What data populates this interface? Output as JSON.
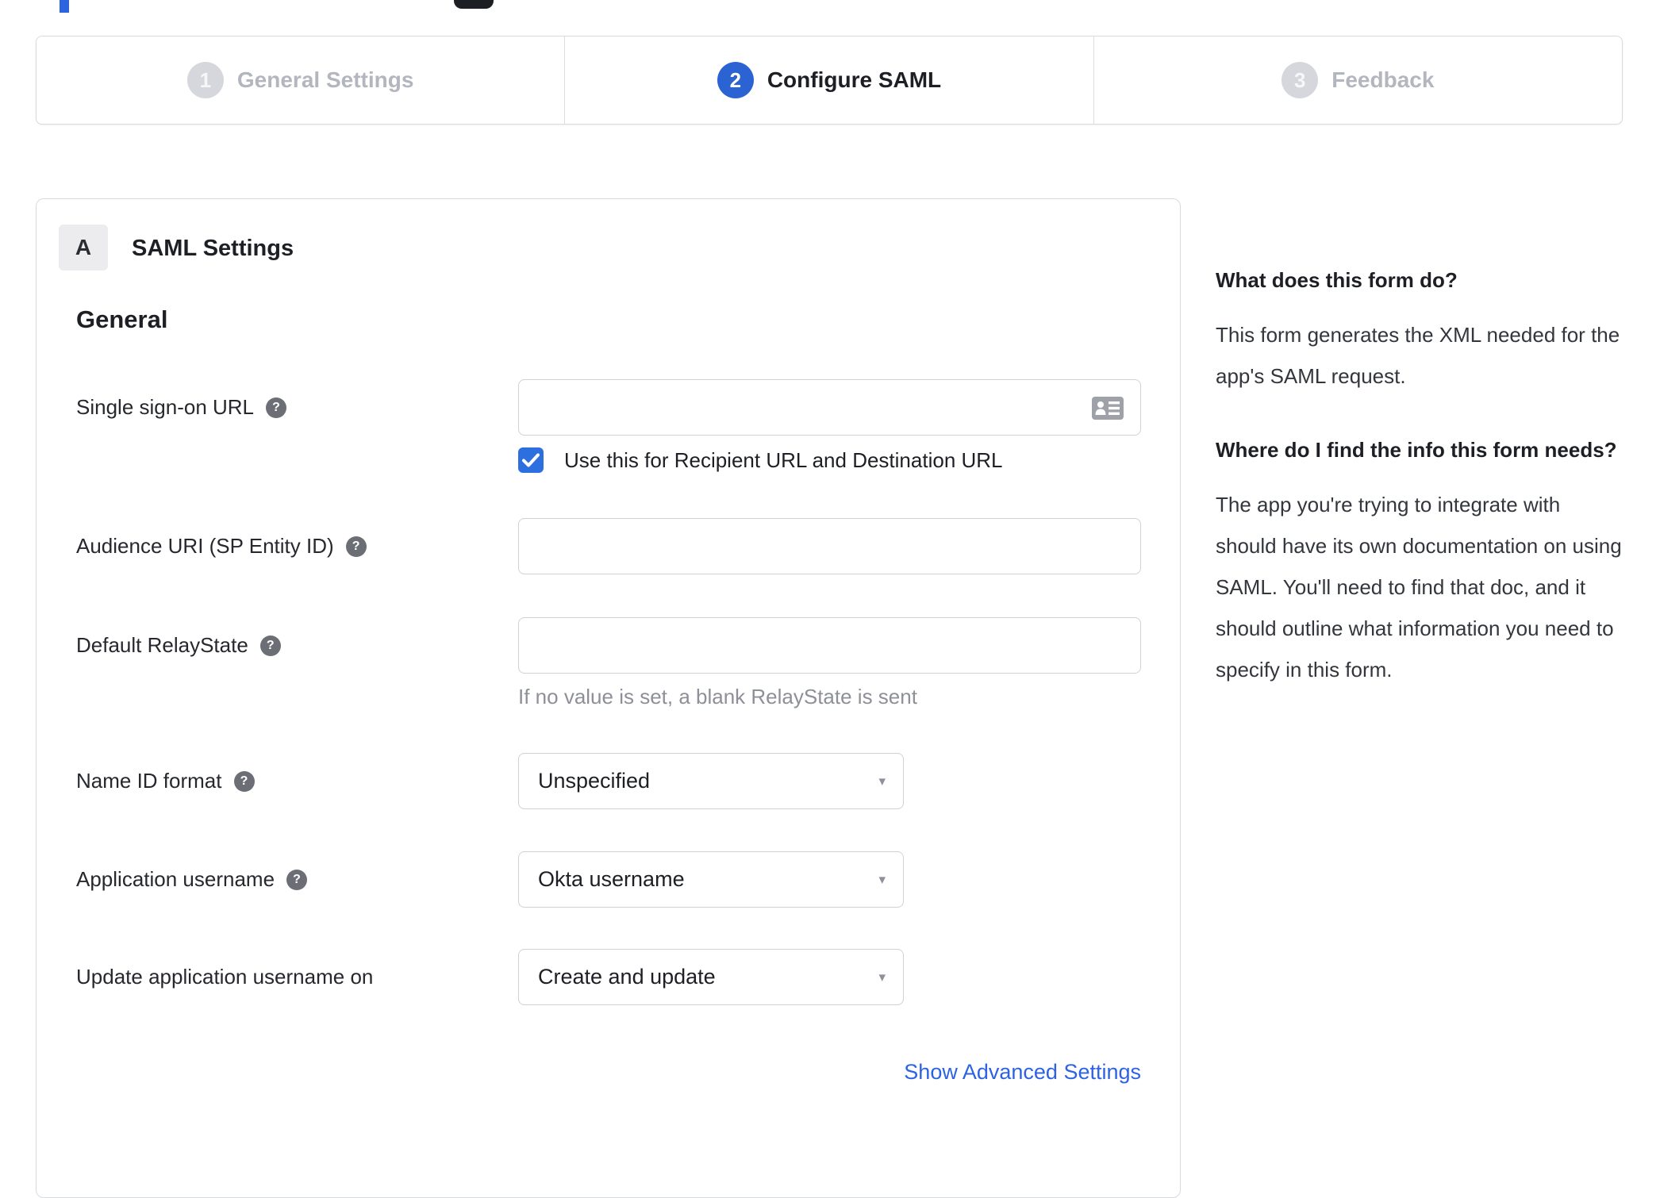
{
  "stepper": {
    "steps": [
      {
        "number": "1",
        "label": "General Settings",
        "state": "inactive"
      },
      {
        "number": "2",
        "label": "Configure SAML",
        "state": "active"
      },
      {
        "number": "3",
        "label": "Feedback",
        "state": "inactive"
      }
    ]
  },
  "panel": {
    "section_badge": "A",
    "section_title": "SAML Settings",
    "subsection_title": "General",
    "advanced_link": "Show Advanced Settings"
  },
  "fields": {
    "sso": {
      "label": "Single sign-on URL",
      "value": "",
      "checkbox_label": "Use this for Recipient URL and Destination URL",
      "checkbox_checked": true
    },
    "audience": {
      "label": "Audience URI (SP Entity ID)",
      "value": ""
    },
    "relay": {
      "label": "Default RelayState",
      "value": "",
      "hint": "If no value is set, a blank RelayState is sent"
    },
    "nameid": {
      "label": "Name ID format",
      "value": "Unspecified"
    },
    "appuser": {
      "label": "Application username",
      "value": "Okta username"
    },
    "updateuser": {
      "label": "Update application username on",
      "value": "Create and update"
    }
  },
  "icons": {
    "help_glyph": "?",
    "caret_glyph": "▾",
    "vcard": "contact-card-icon",
    "checkmark": "checkmark-icon"
  },
  "sidebar": {
    "sections": [
      {
        "heading": "What does this form do?",
        "body": "This form generates the XML needed for the app's SAML request."
      },
      {
        "heading": "Where do I find the info this form needs?",
        "body": "The app you're trying to integrate with should have its own documentation on using SAML. You'll need to find that doc, and it should outline what information you need to specify in this form."
      }
    ]
  },
  "colors": {
    "active_step_blue": "#2b63d2",
    "checkbox_blue": "#2e6fe0",
    "link_blue": "#2d63e3",
    "inactive_gray": "#b3b6be",
    "border_gray": "#d8dade",
    "hint_gray": "#8d9097"
  }
}
